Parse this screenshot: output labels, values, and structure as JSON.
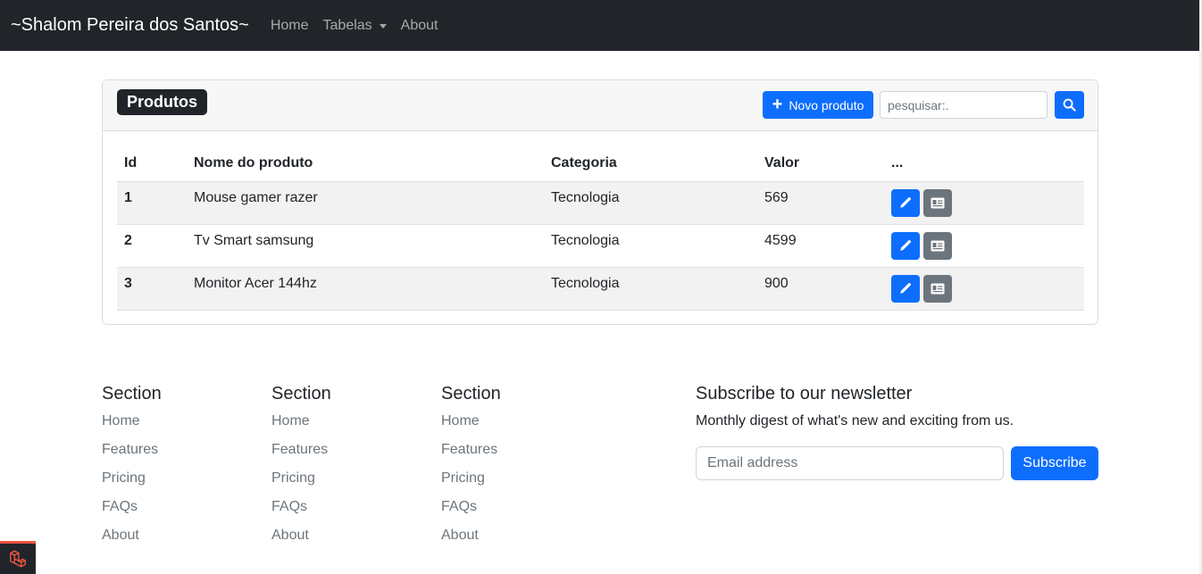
{
  "navbar": {
    "brand": "~Shalom Pereira dos Santos~",
    "links": [
      "Home",
      "Tabelas",
      "About"
    ]
  },
  "card": {
    "title": "Produtos",
    "new_button_label": "Novo produto",
    "search_placeholder": "pesquisar:."
  },
  "table": {
    "headers": [
      "Id",
      "Nome do produto",
      "Categoria",
      "Valor",
      "..."
    ],
    "rows": [
      [
        "1",
        "Mouse gamer razer",
        "Tecnologia",
        "569"
      ],
      [
        "2",
        "Tv Smart samsung",
        "Tecnologia",
        "4599"
      ],
      [
        "3",
        "Monitor Acer 144hz",
        "Tecnologia",
        "900"
      ]
    ]
  },
  "footer": {
    "sections": [
      {
        "title": "Section",
        "links": [
          "Home",
          "Features",
          "Pricing",
          "FAQs",
          "About"
        ]
      },
      {
        "title": "Section",
        "links": [
          "Home",
          "Features",
          "Pricing",
          "FAQs",
          "About"
        ]
      },
      {
        "title": "Section",
        "links": [
          "Home",
          "Features",
          "Pricing",
          "FAQs",
          "About"
        ]
      }
    ],
    "newsletter": {
      "title": "Subscribe to our newsletter",
      "subtitle": "Monthly digest of what's new and exciting from us.",
      "email_placeholder": "Email address",
      "button_label": "Subscribe"
    }
  },
  "colors": {
    "navbar_bg": "#212529",
    "primary": "#0d6efd",
    "secondary": "#6c757d",
    "laravel_red": "#f05340"
  },
  "icons": {
    "add": "plus-icon",
    "search": "search-icon",
    "edit": "pencil-icon",
    "details": "id-card-icon",
    "dropdown": "caret-down-icon",
    "framework": "laravel-icon"
  }
}
